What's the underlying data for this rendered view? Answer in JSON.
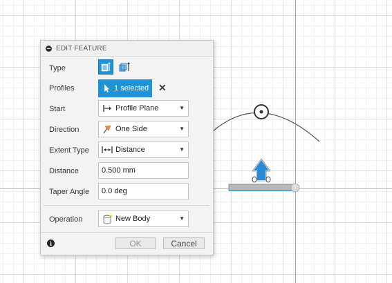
{
  "dialog": {
    "title": "EDIT FEATURE",
    "fields": {
      "type_label": "Type",
      "profiles_label": "Profiles",
      "profiles_value": "1 selected",
      "start_label": "Start",
      "start_value": "Profile Plane",
      "direction_label": "Direction",
      "direction_value": "One Side",
      "extent_label": "Extent Type",
      "extent_value": "Distance",
      "distance_label": "Distance",
      "distance_value": "0.500 mm",
      "taper_label": "Taper Angle",
      "taper_value": "0.0 deg",
      "operation_label": "Operation",
      "operation_value": "New Body"
    },
    "buttons": {
      "ok": "OK",
      "cancel": "Cancel"
    }
  },
  "colors": {
    "accent": "#1f93d6",
    "x_axis": "#e8a3a3",
    "y_axis": "#9b9bd6",
    "manipulator": "#2b8ad6"
  },
  "icons": {
    "type_1": "extrude-solid-icon",
    "type_2": "extrude-thin-icon",
    "profiles": "cursor-icon",
    "start": "profile-plane-icon",
    "direction": "one-side-flag-icon",
    "extent": "distance-icon",
    "operation": "new-body-icon",
    "info": "info-icon"
  }
}
